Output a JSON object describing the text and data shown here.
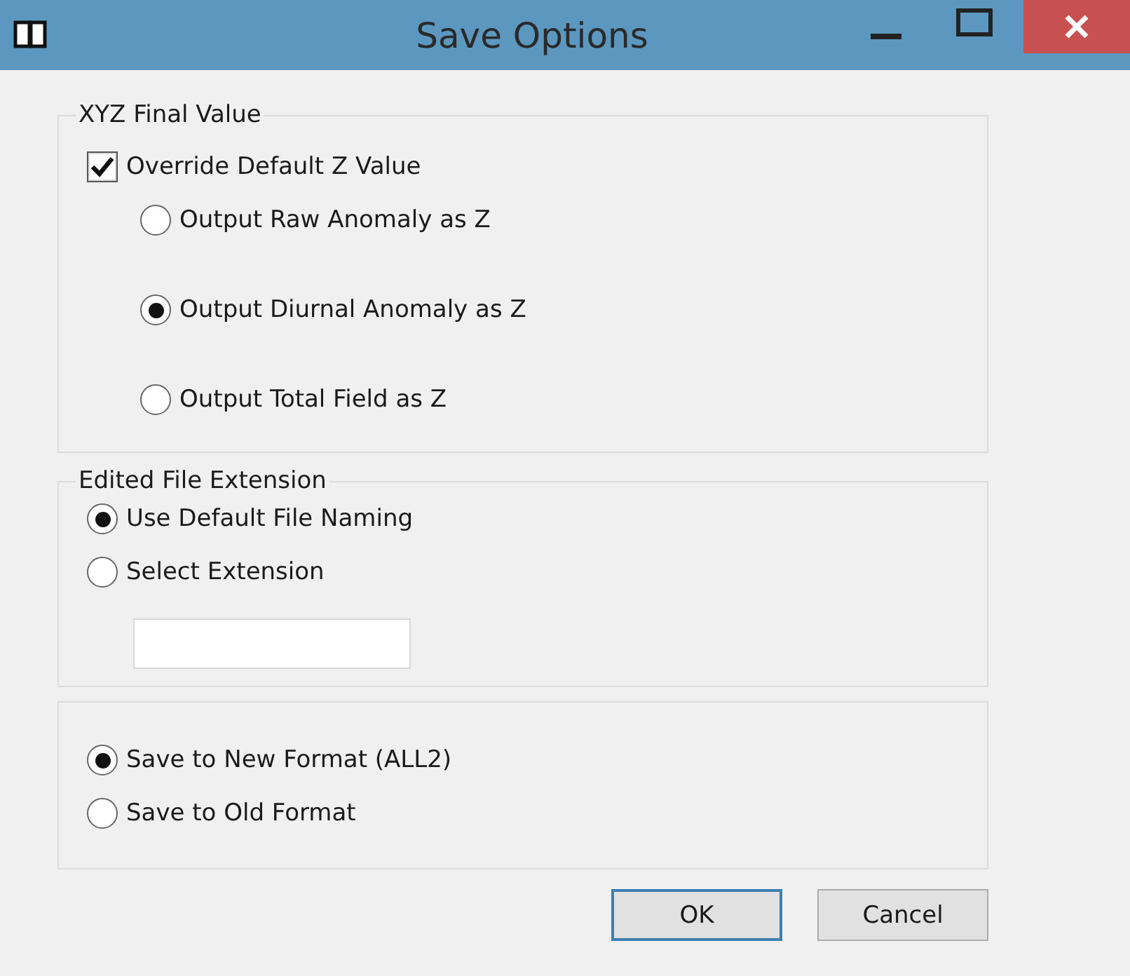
{
  "window": {
    "title": "Save Options"
  },
  "groups": [
    {
      "legend": "XYZ Final Value",
      "items": [
        {
          "kind": "checkbox",
          "label": "Override Default Z Value",
          "checked": true,
          "children": [
            {
              "kind": "radio",
              "label": "Output Raw Anomaly as Z",
              "selected": false
            },
            {
              "kind": "radio",
              "label": "Output Diurnal Anomaly as Z",
              "selected": true
            },
            {
              "kind": "radio",
              "label": "Output Total Field as Z",
              "selected": false
            }
          ]
        }
      ]
    },
    {
      "legend": "Edited File Extension",
      "items": [
        {
          "kind": "radio",
          "label": "Use Default File Naming",
          "selected": true
        },
        {
          "kind": "radio",
          "label": "Select Extension",
          "selected": false
        },
        {
          "kind": "field"
        }
      ]
    },
    {
      "items": [
        {
          "kind": "radio",
          "label": "Save to New Format (ALL2)",
          "selected": true
        },
        {
          "kind": "radio",
          "label": "Save to Old Format",
          "selected": false
        }
      ]
    }
  ],
  "buttons": [
    {
      "label": "OK",
      "default": true
    },
    {
      "label": "Cancel",
      "default": false
    }
  ]
}
